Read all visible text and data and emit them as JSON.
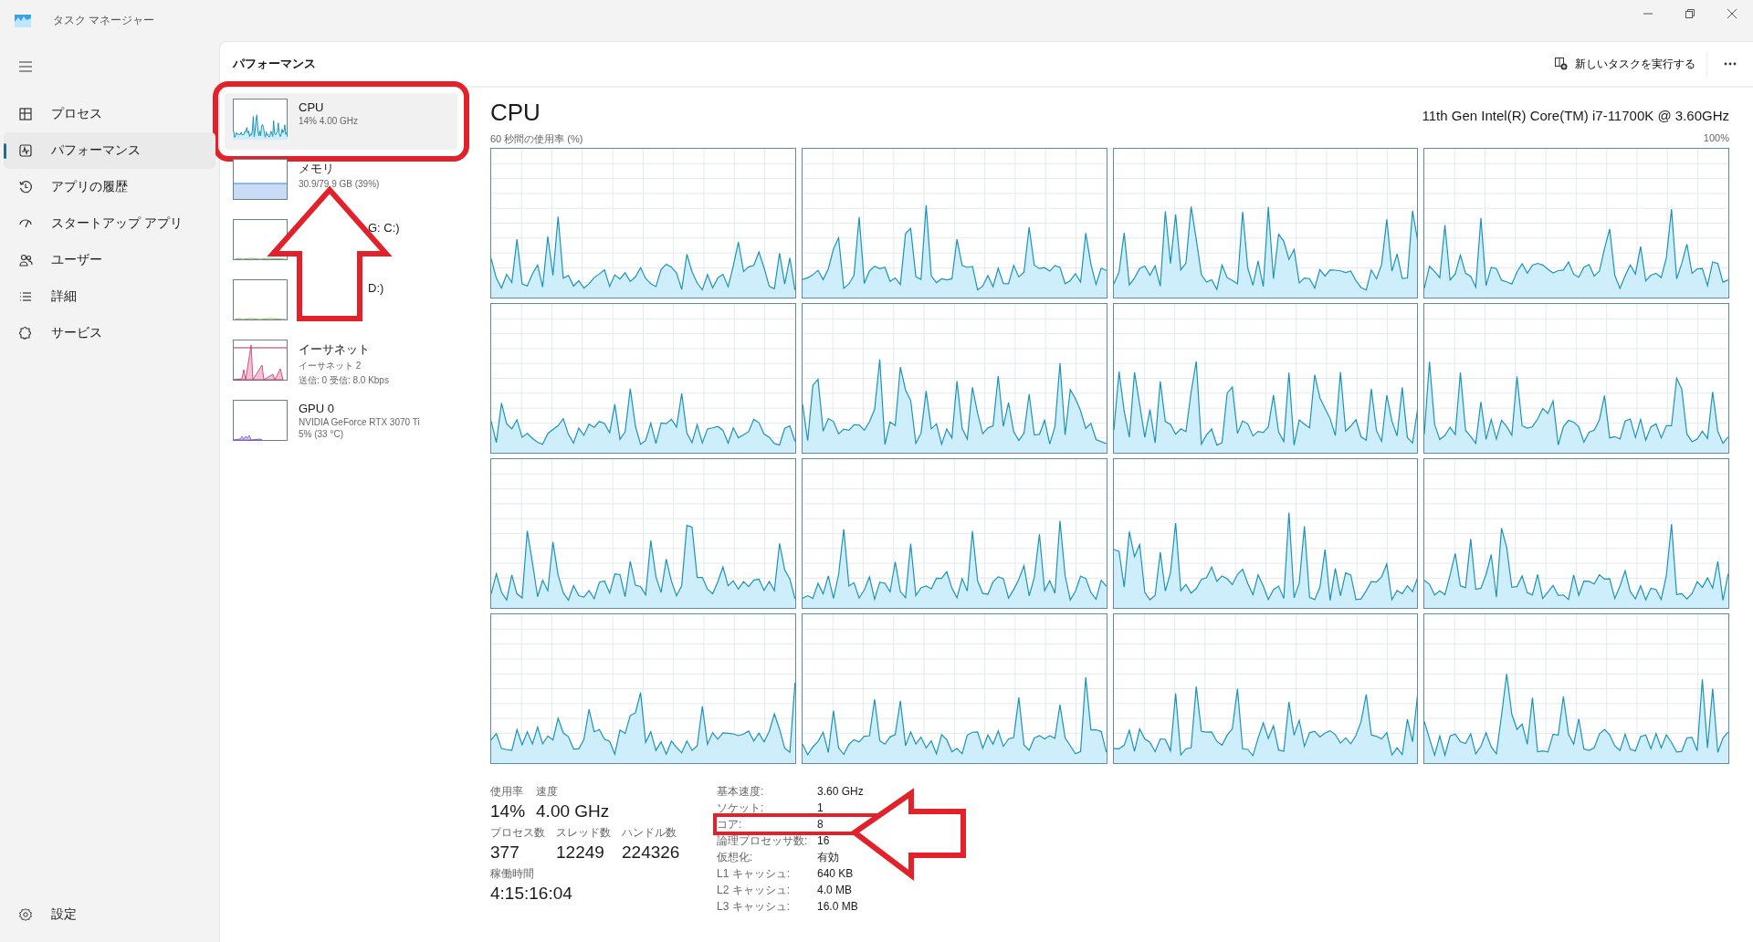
{
  "window": {
    "title": "タスク マネージャー"
  },
  "nav": {
    "items": [
      {
        "label": "プロセス",
        "selected": false
      },
      {
        "label": "パフォーマンス",
        "selected": true
      },
      {
        "label": "アプリの履歴",
        "selected": false
      },
      {
        "label": "スタートアップ アプリ",
        "selected": false
      },
      {
        "label": "ユーザー",
        "selected": false
      },
      {
        "label": "詳細",
        "selected": false
      },
      {
        "label": "サービス",
        "selected": false
      }
    ],
    "settings": "設定"
  },
  "header": {
    "title": "パフォーマンス",
    "run_task": "新しいタスクを実行する"
  },
  "devices": [
    {
      "kind": "cpu",
      "title": "CPU",
      "lines": [
        "14%  4.00 GHz"
      ],
      "selected": true,
      "annotated": true
    },
    {
      "kind": "memory",
      "title": "メモリ",
      "lines": [
        "30.9/79.9 GB (39%)"
      ],
      "selected": false,
      "annotated": false
    },
    {
      "kind": "disk",
      "visible_title": "G: C:)",
      "selected": false,
      "annotated": false
    },
    {
      "kind": "disk",
      "visible_title": "D:)",
      "selected": false,
      "annotated": false
    },
    {
      "kind": "ethernet",
      "title": "イーサネット",
      "lines": [
        "イーサネット 2",
        "送信: 0 受信: 8.0 Kbps"
      ],
      "selected": false,
      "annotated": false
    },
    {
      "kind": "gpu",
      "title": "GPU 0",
      "lines": [
        "NVIDIA GeForce RTX 3070 Ti",
        "5%  (33 °C)"
      ],
      "selected": false,
      "annotated": false
    }
  ],
  "detail": {
    "title": "CPU",
    "model": "11th Gen Intel(R) Core(TM) i7-11700K @ 3.60GHz",
    "graph_label": "60 秒間の使用率 (%)",
    "graph_max": "100%",
    "core_graphs": [
      {
        "kind": "picture"
      },
      {
        "kind": "picture"
      },
      {
        "kind": "picture"
      },
      {
        "kind": "picture"
      },
      {
        "kind": "picture"
      },
      {
        "kind": "picture"
      },
      {
        "kind": "picture"
      },
      {
        "kind": "picture"
      },
      {
        "kind": "picture"
      },
      {
        "kind": "picture"
      },
      {
        "kind": "picture"
      },
      {
        "kind": "picture"
      },
      {
        "kind": "picture"
      },
      {
        "kind": "picture"
      },
      {
        "kind": "picture"
      },
      {
        "kind": "picture"
      }
    ],
    "stats": [
      [
        {
          "label": "使用率",
          "value": "14%"
        },
        {
          "label": "速度",
          "value": "4.00 GHz"
        }
      ],
      [
        {
          "label": "プロセス数",
          "value": "377"
        },
        {
          "label": "スレッド数",
          "value": "12249"
        },
        {
          "label": "ハンドル数",
          "value": "224326"
        }
      ],
      [
        {
          "label": "稼働時間",
          "value": "4:15:16:04"
        }
      ]
    ],
    "specs": [
      {
        "label": "基本速度:",
        "value": "3.60 GHz",
        "annotated": false
      },
      {
        "label": "ソケット:",
        "value": "1",
        "annotated": false
      },
      {
        "label": "コア:",
        "value": "8",
        "annotated": true
      },
      {
        "label": "論理プロセッサ数:",
        "value": "16",
        "annotated": false
      },
      {
        "label": "仮想化:",
        "value": "有効",
        "annotated": false
      },
      {
        "label": "L1 キャッシュ:",
        "value": "640 KB",
        "annotated": false
      },
      {
        "label": "L2 キャッシュ:",
        "value": "4.0 MB",
        "annotated": false
      },
      {
        "label": "L3 キャッシュ:",
        "value": "16.0 MB",
        "annotated": false
      }
    ]
  }
}
